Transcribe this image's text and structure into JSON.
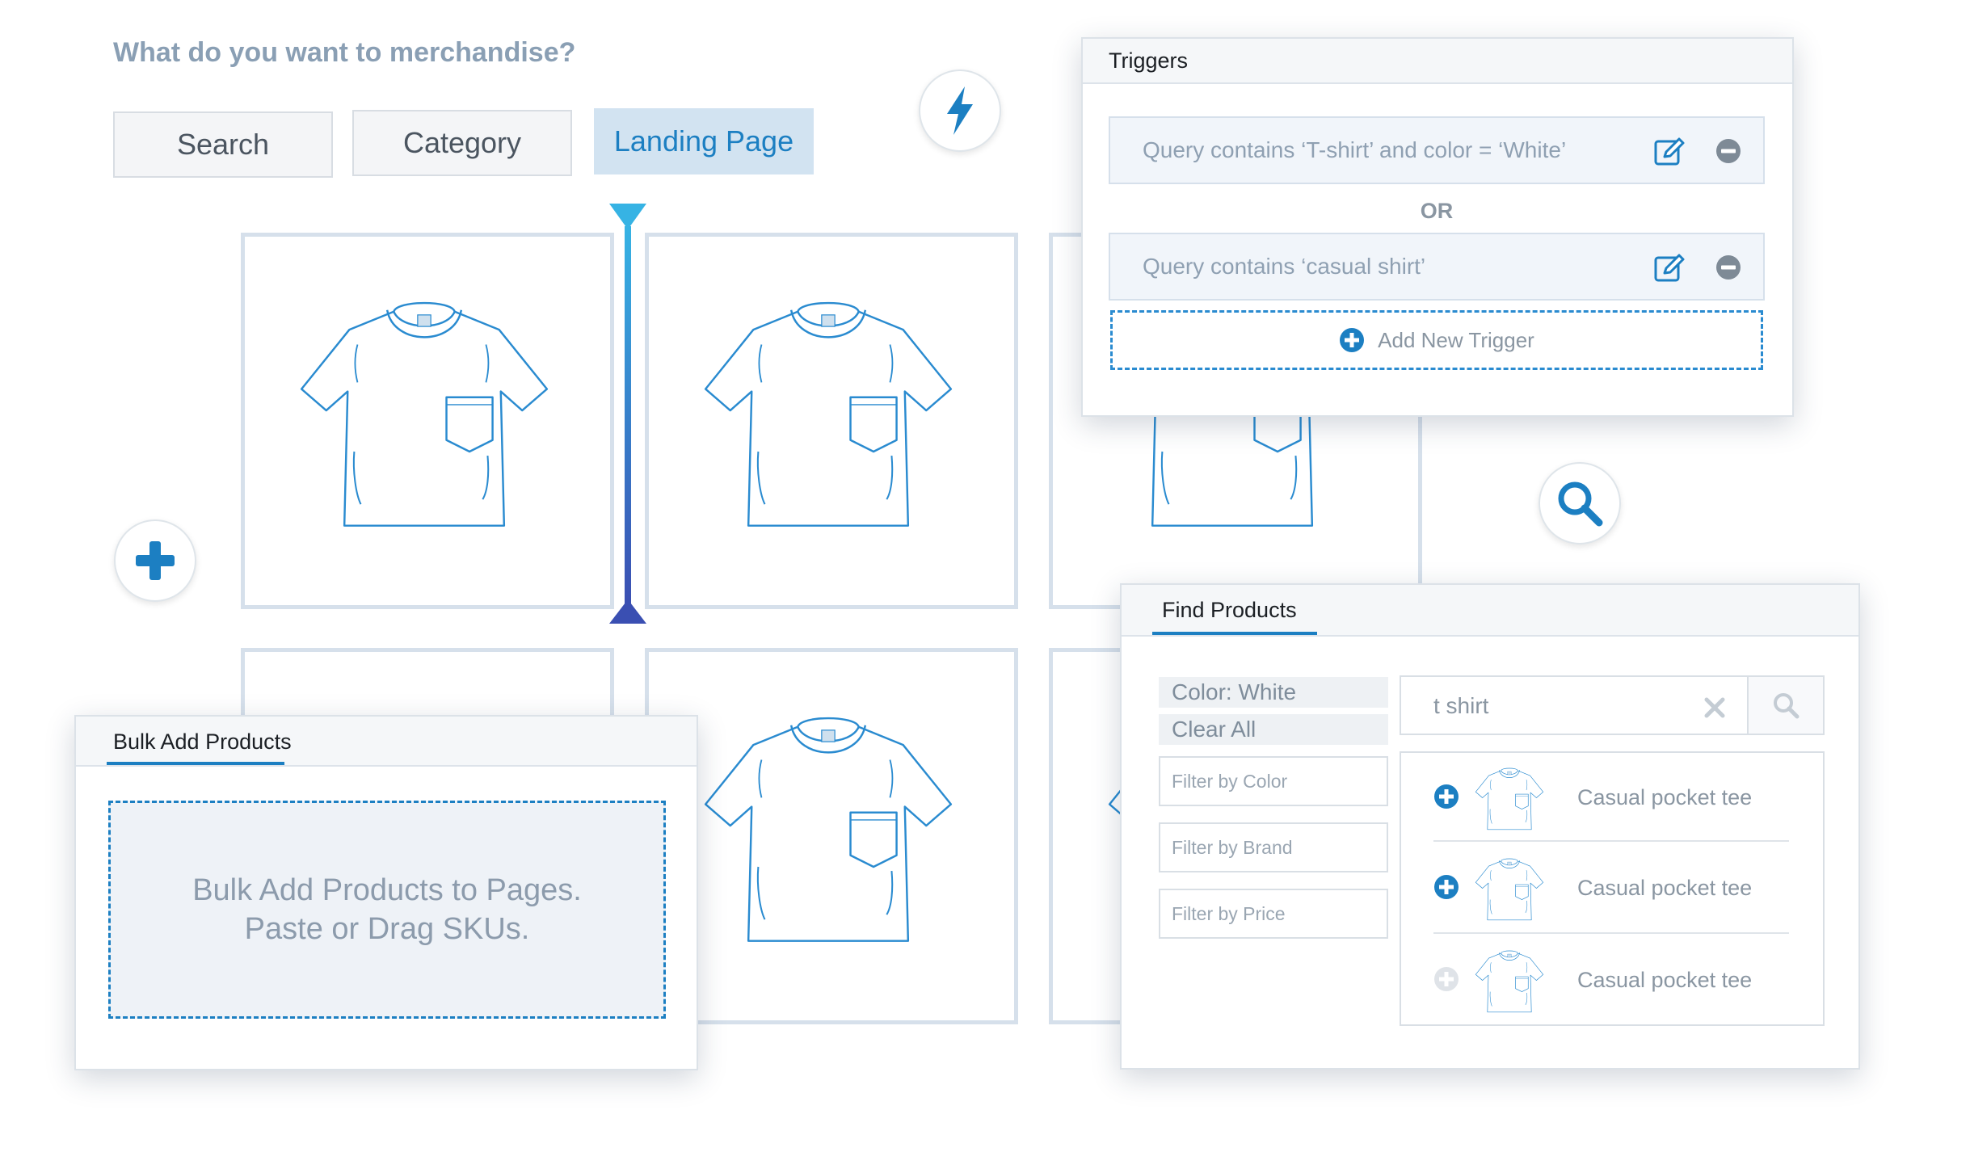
{
  "heading": "What do you want to merchandise?",
  "modes": [
    {
      "label": "Search",
      "active": false
    },
    {
      "label": "Category",
      "active": false
    },
    {
      "label": "Landing Page",
      "active": true
    }
  ],
  "icons": {
    "lightning": "lightning-icon",
    "add": "plus-icon",
    "search": "magnifier-icon",
    "edit": "edit-icon",
    "remove": "minus-circle-icon",
    "clear": "x-icon",
    "product": "tshirt-icon"
  },
  "colors": {
    "accent": "#1c7fc2",
    "active_tab_bg": "#d2e3f1",
    "tile_border": "#d6e0eb",
    "text_muted": "#8a9fb4"
  },
  "triggers_panel": {
    "title": "Triggers",
    "triggers": [
      {
        "text": "Query contains ‘T-shirt’ and color = ‘White’"
      },
      {
        "text": "Query contains ‘casual shirt’"
      }
    ],
    "separator": "OR",
    "add_label": "Add New Trigger"
  },
  "bulk_panel": {
    "title": "Bulk Add Products",
    "dropzone_line1": "Bulk Add Products to Pages.",
    "dropzone_line2": "Paste or Drag SKUs."
  },
  "find_panel": {
    "title": "Find Products",
    "active_filters": [
      "Color: White",
      "Clear All"
    ],
    "filters": [
      "Filter by Color",
      "Filter by Brand",
      "Filter by Price"
    ],
    "search_value": "t shirt",
    "results": [
      {
        "name": "Casual pocket tee",
        "addable": true
      },
      {
        "name": "Casual pocket tee",
        "addable": true
      },
      {
        "name": "Casual pocket tee",
        "addable": false
      }
    ]
  }
}
